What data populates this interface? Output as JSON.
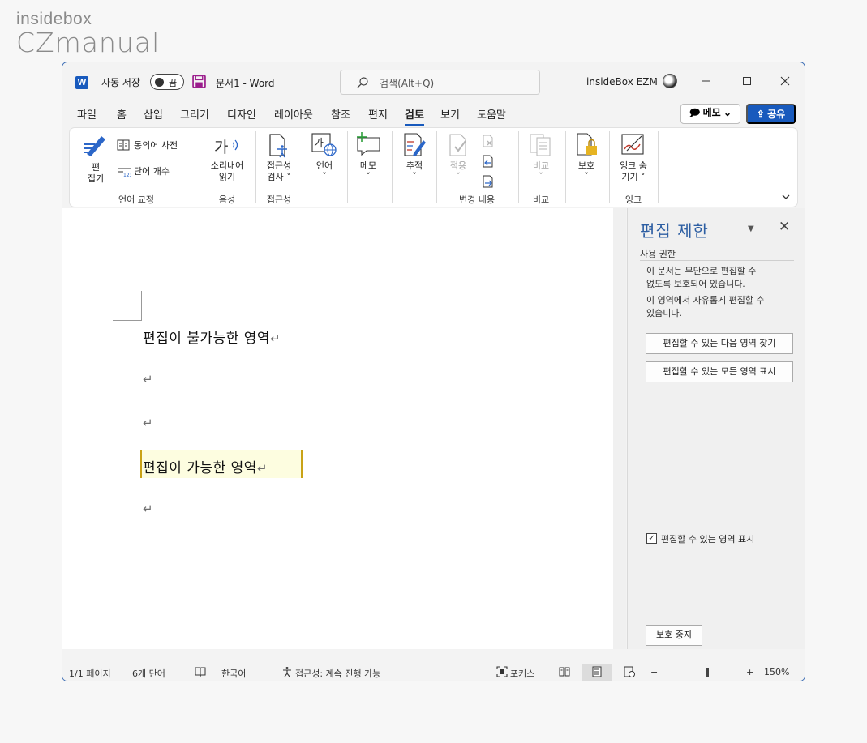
{
  "watermark": {
    "line1": "insidebox",
    "line2": "CZmanual"
  },
  "titlebar": {
    "app_icon": "W",
    "autosave_label": "자동 저장",
    "autosave_state": "끔",
    "doc_title": "문서1  -  Word",
    "search_placeholder": "검색(Alt+Q)",
    "user": "insideBox EZM"
  },
  "tabs": [
    "파일",
    "홈",
    "삽입",
    "그리기",
    "디자인",
    "레이아웃",
    "참조",
    "편지",
    "검토",
    "보기",
    "도움말"
  ],
  "active_tab": "검토",
  "header_buttons": {
    "memo": "메모",
    "share": "공유"
  },
  "ribbon": {
    "proofing": {
      "editor_line1": "편",
      "editor_line2": "집기",
      "thesaurus": "동의어 사전",
      "wordcount": "단어 개수",
      "title": "언어 교정"
    },
    "speech": {
      "read_aloud_line1": "소리내어",
      "read_aloud_line2": "읽기",
      "title": "음성"
    },
    "accessibility": {
      "check_line1": "접근성",
      "check_line2": "검사 ˅",
      "title": "접근성"
    },
    "language": {
      "label": "언어",
      "caret": "˅"
    },
    "comments": {
      "label": "메모",
      "caret": "˅"
    },
    "tracking": {
      "label": "추적",
      "caret": "˅"
    },
    "changes": {
      "accept": "적용",
      "caret": "˅",
      "title": "변경 내용"
    },
    "compare": {
      "label": "비교",
      "caret": "˅",
      "title": "비교"
    },
    "protect": {
      "label": "보호",
      "caret": "˅"
    },
    "ink": {
      "line1": "잉크 숨",
      "line2": "기기 ˅",
      "title": "잉크"
    }
  },
  "document": {
    "line1": "편집이 불가능한 영역",
    "line2": "편집이 가능한 영역",
    "para_mark": "↵"
  },
  "pane": {
    "title": "편집 제한",
    "section": "사용 권한",
    "text1_line1": "이 문서는 무단으로 편집할 수",
    "text1_line2": "없도록 보호되어 있습니다.",
    "text2_line1": "이 영역에서 자유롭게 편집할 수",
    "text2_line2": "있습니다.",
    "btn_find_next": "편집할 수 있는 다음 영역 찾기",
    "btn_show_all": "편집할 수 있는 모든 영역 표시",
    "checkbox_label": "편집할 수 있는 영역 표시",
    "checkbox_checked": true,
    "stop_button": "보호 중지"
  },
  "status": {
    "page": "1/1 페이지",
    "words": "6개 단어",
    "language": "한국어",
    "accessibility": "접근성: 계속 진행 가능",
    "focus": "포커스",
    "zoom_minus": "−",
    "zoom_plus": "+",
    "zoom": "150%"
  },
  "colors": {
    "accent": "#185abd",
    "editable_highlight": "#fdfde0",
    "editable_bracket": "#c9a216",
    "pane_title": "#2e5fa3"
  }
}
